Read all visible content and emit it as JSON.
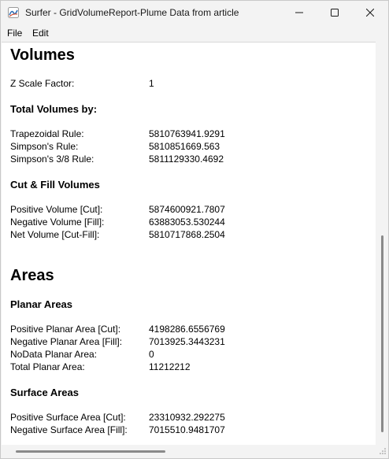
{
  "window": {
    "title": "Surfer - GridVolumeReport-Plume Data from article",
    "icons": {
      "app": "surfer-app-icon",
      "minimize": "minimize-icon",
      "maximize": "maximize-icon",
      "close": "close-icon"
    }
  },
  "menu": {
    "items": [
      {
        "label": "File"
      },
      {
        "label": "Edit"
      }
    ]
  },
  "report": {
    "volumes": {
      "heading": "Volumes",
      "z_scale": {
        "label": "Z Scale Factor:",
        "value": "1"
      },
      "total_heading": "Total Volumes by:",
      "total_rows": [
        {
          "label": "Trapezoidal Rule:",
          "value": "5810763941.9291"
        },
        {
          "label": "Simpson's Rule:",
          "value": "5810851669.563"
        },
        {
          "label": "Simpson's 3/8 Rule:",
          "value": "5811129330.4692"
        }
      ],
      "cutfill_heading": "Cut & Fill Volumes",
      "cutfill_rows": [
        {
          "label": "Positive Volume [Cut]:",
          "value": "5874600921.7807"
        },
        {
          "label": "Negative Volume [Fill]:",
          "value": "63883053.530244"
        },
        {
          "label": "Net Volume [Cut-Fill]:",
          "value": "5810717868.2504"
        }
      ]
    },
    "areas": {
      "heading": "Areas",
      "planar_heading": "Planar Areas",
      "planar_rows": [
        {
          "label": "Positive Planar Area [Cut]:",
          "value": "4198286.6556769"
        },
        {
          "label": "Negative Planar Area [Fill]:",
          "value": "7013925.3443231"
        },
        {
          "label": "NoData Planar Area:",
          "value": "0"
        },
        {
          "label": "Total Planar Area:",
          "value": "11212212"
        }
      ],
      "surface_heading": "Surface Areas",
      "surface_rows": [
        {
          "label": "Positive Surface Area [Cut]:",
          "value": "23310932.292275"
        },
        {
          "label": "Negative Surface Area [Fill]:",
          "value": "7015510.9481707"
        }
      ]
    }
  },
  "colors": {
    "chrome": "#f3f3f3",
    "content_bg": "#ffffff",
    "scroll_thumb": "#8a8a8a",
    "app_icon_blue": "#2f6fb6"
  }
}
